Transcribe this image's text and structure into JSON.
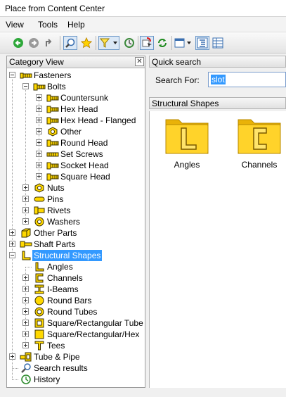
{
  "window": {
    "title": "Place from Content Center"
  },
  "menu": [
    {
      "label": "View"
    },
    {
      "label": "Tools"
    },
    {
      "label": "Help"
    }
  ],
  "toolbar": {
    "buttons": [
      {
        "icon": "back-arrow-icon"
      },
      {
        "icon": "forward-arrow-icon"
      },
      {
        "icon": "up-level-icon"
      },
      {
        "icon": "search-icon"
      },
      {
        "icon": "favorites-star-icon"
      },
      {
        "icon": "filter-icon"
      },
      {
        "icon": "refresh-icon"
      },
      {
        "icon": "member-select-icon"
      },
      {
        "icon": "update-icon"
      },
      {
        "icon": "view-options-icon"
      },
      {
        "icon": "tree-view-icon"
      },
      {
        "icon": "table-view-icon"
      }
    ]
  },
  "left_panel": {
    "title": "Category View",
    "close_label": "✕",
    "tree": [
      {
        "label": "Fasteners",
        "level": 0,
        "expander": "minus",
        "icon": "fastener"
      },
      {
        "label": "Bolts",
        "level": 1,
        "expander": "minus",
        "icon": "bolt"
      },
      {
        "label": "Countersunk",
        "level": 2,
        "expander": "plus",
        "icon": "bolt"
      },
      {
        "label": "Hex Head",
        "level": 2,
        "expander": "plus",
        "icon": "bolt"
      },
      {
        "label": "Hex Head - Flanged",
        "level": 2,
        "expander": "plus",
        "icon": "bolt"
      },
      {
        "label": "Other",
        "level": 2,
        "expander": "plus",
        "icon": "nut"
      },
      {
        "label": "Round Head",
        "level": 2,
        "expander": "plus",
        "icon": "bolt"
      },
      {
        "label": "Set Screws",
        "level": 2,
        "expander": "plus",
        "icon": "screw"
      },
      {
        "label": "Socket Head",
        "level": 2,
        "expander": "plus",
        "icon": "bolt"
      },
      {
        "label": "Square Head",
        "level": 2,
        "expander": "plus",
        "icon": "bolt"
      },
      {
        "label": "Nuts",
        "level": 1,
        "expander": "plus",
        "icon": "nut"
      },
      {
        "label": "Pins",
        "level": 1,
        "expander": "plus",
        "icon": "pin"
      },
      {
        "label": "Rivets",
        "level": 1,
        "expander": "plus",
        "icon": "rivet"
      },
      {
        "label": "Washers",
        "level": 1,
        "expander": "plus",
        "icon": "washer"
      },
      {
        "label": "Other Parts",
        "level": 0,
        "expander": "plus",
        "icon": "cube"
      },
      {
        "label": "Shaft Parts",
        "level": 0,
        "expander": "plus",
        "icon": "shaft"
      },
      {
        "label": "Structural Shapes",
        "level": 0,
        "expander": "minus",
        "icon": "angle",
        "selected": true
      },
      {
        "label": "Angles",
        "level": 1,
        "expander": "none",
        "icon": "angle"
      },
      {
        "label": "Channels",
        "level": 1,
        "expander": "plus",
        "icon": "channel"
      },
      {
        "label": "I-Beams",
        "level": 1,
        "expander": "plus",
        "icon": "ibeam"
      },
      {
        "label": "Round Bars",
        "level": 1,
        "expander": "plus",
        "icon": "roundbar"
      },
      {
        "label": "Round Tubes",
        "level": 1,
        "expander": "plus",
        "icon": "roundtube"
      },
      {
        "label": "Square/Rectangular Tube",
        "level": 1,
        "expander": "plus",
        "icon": "squaretube"
      },
      {
        "label": "Square/Rectangular/Hex",
        "level": 1,
        "expander": "plus",
        "icon": "squarebar"
      },
      {
        "label": "Tees",
        "level": 1,
        "expander": "plus",
        "icon": "tee"
      },
      {
        "label": "Tube & Pipe",
        "level": 0,
        "expander": "plus",
        "icon": "pipe"
      },
      {
        "label": "Search results",
        "level": 0,
        "expander": "none",
        "icon": "search"
      },
      {
        "label": "History",
        "level": 0,
        "expander": "none",
        "icon": "history"
      }
    ]
  },
  "quick_search": {
    "title": "Quick search",
    "label": "Search For:",
    "value": "slot"
  },
  "content": {
    "title": "Structural Shapes",
    "folders": [
      {
        "label": "Angles",
        "glyph": "angle"
      },
      {
        "label": "Channels",
        "glyph": "channel"
      }
    ]
  },
  "colors": {
    "selection": "#3399ff",
    "folder": "#f5c518",
    "icon_yellow": "#ffd800"
  }
}
